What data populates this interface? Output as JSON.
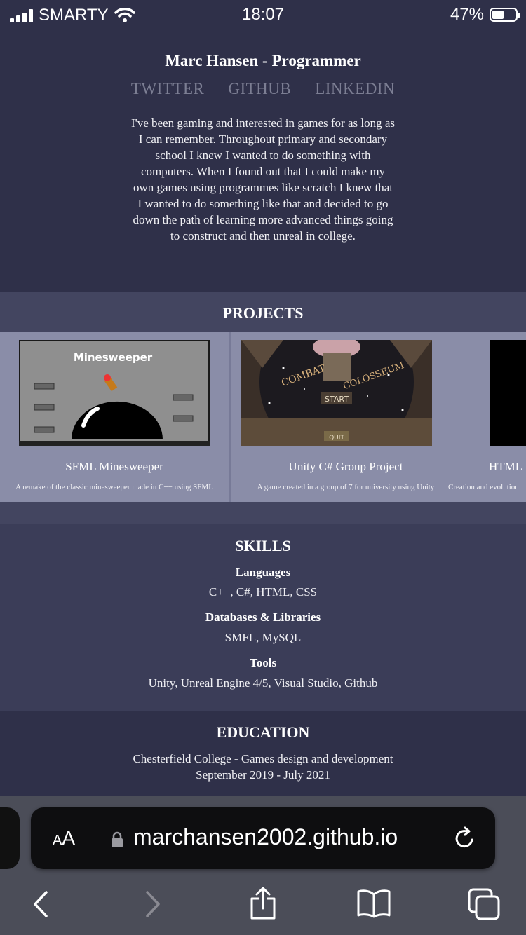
{
  "status": {
    "carrier": "SMARTY",
    "time": "18:07",
    "battery": "47%",
    "battery_level": 0.47
  },
  "profile": {
    "name": "Marc Hansen - Programmer",
    "links": [
      "TWITTER",
      "GITHUB",
      "LINKEDIN"
    ],
    "bio": "I've been gaming and interested in games for as long as I can remember. Throughout primary and secondary school I knew I wanted to do something with computers. When I found out that I could make my own games using programmes like scratch I knew that I wanted to do something like that and decided to go down the path of learning more advanced things going to construct and then unreal in college."
  },
  "projects": {
    "heading": "PROJECTS",
    "items": [
      {
        "title": "SFML Minesweeper",
        "description": "A remake of the classic minesweeper made in C++ using SFML",
        "thumb_text": "Minesweeper"
      },
      {
        "title": "Unity C# Group Project",
        "description": "A game created in a group of 7 for university using Unity",
        "thumb_text": [
          "COMBAT",
          "COLOSSEUM",
          "START",
          "QUIT"
        ]
      },
      {
        "title": "HTML",
        "description": "Creation and evolution"
      }
    ]
  },
  "skills": {
    "heading": "SKILLS",
    "groups": [
      {
        "label": "Languages",
        "value": "C++, C#, HTML, CSS"
      },
      {
        "label": "Databases & Libraries",
        "value": "SMFL, MySQL"
      },
      {
        "label": "Tools",
        "value": "Unity, Unreal Engine 4/5, Visual Studio, Github"
      }
    ]
  },
  "education": {
    "heading": "EDUCATION",
    "lines": [
      "Chesterfield College - Games design and development",
      "September 2019 - July 2021"
    ]
  },
  "browser": {
    "aa_label": "AA",
    "url": "marchansen2002.github.io",
    "icons": [
      "lock-icon",
      "reload-icon",
      "back-icon",
      "forward-icon",
      "share-icon",
      "bookmarks-icon",
      "tabs-icon"
    ]
  }
}
